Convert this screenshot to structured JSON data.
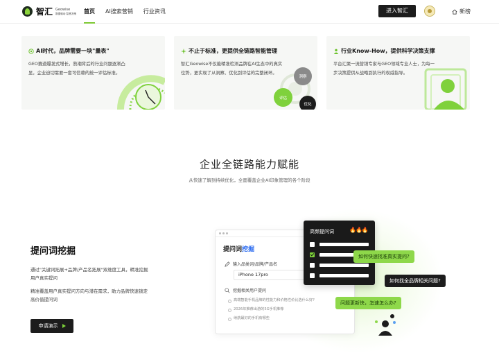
{
  "header": {
    "logo_cn": "智汇",
    "logo_sub_1": "Geowise",
    "logo_sub_2": "数据驱动 智慧决策",
    "nav": [
      {
        "label": "首页",
        "active": true
      },
      {
        "label": "AI搜索营销",
        "active": false
      },
      {
        "label": "行业资讯",
        "active": false
      }
    ],
    "enter_label": "进入智汇",
    "home_label": "新榜"
  },
  "cards": [
    {
      "title": "AI时代，品牌需要一块\"量表\"",
      "desc": "GEO赛道爆发式增长，熟潮背后的行业问题逐渐凸显，企业迫切需要一套可信赖的统一评估标准。",
      "icon": "gauge-icon"
    },
    {
      "title": "不止于标准，更提供全链路智能管理",
      "desc": "智汇Geowise不仅能精准检测品牌在AI生态中的真实位势，更实现了从洞察、优化到评估的完整闭环。",
      "icon": "sparkle-icon",
      "tags": [
        "洞察",
        "评估",
        "优化"
      ]
    },
    {
      "title": "行业Know-How，提供科学决策支撑",
      "desc": "平台汇聚一流营销专家与GEO领域专业人士，为每一步决策提供从战略到执行的权威指导。",
      "icon": "expert-icon"
    }
  ],
  "section": {
    "title": "企业全链路能力赋能",
    "subtitle": "从快速了解到持续优化，全面覆盖企业AI印象管理的各个阶段"
  },
  "feature": {
    "title": "提问词挖掘",
    "p1": "通过\"关键词拓展+品牌/产品名拓展\"双维度工具，精准挖掘用户真实提问",
    "p2": "精准覆盖用户真实提问方向与潜在需求，助力品牌快速锁定高价值提问词",
    "demo_label": "申请演示"
  },
  "illustration": {
    "window_title_plain": "提问词",
    "window_title_hl": "挖掘",
    "row1_label": "输入品类词/品牌/产品名",
    "input_value": "iPhone 17pro",
    "row2_label": "挖掘相关用户提问",
    "list": [
      "高端智能手机品牌的性能力和价格性价比选什么好?",
      "2026年推荐出游的5G手机推荐",
      "续航最好的手机有哪些"
    ],
    "panel_title": "高频提问词",
    "panel_fire": "🔥🔥🔥",
    "bubbles": [
      "如何快速找准真实提问?",
      "如何找全品牌相关问题?",
      "问题更新快，怎速怎么办?"
    ]
  }
}
